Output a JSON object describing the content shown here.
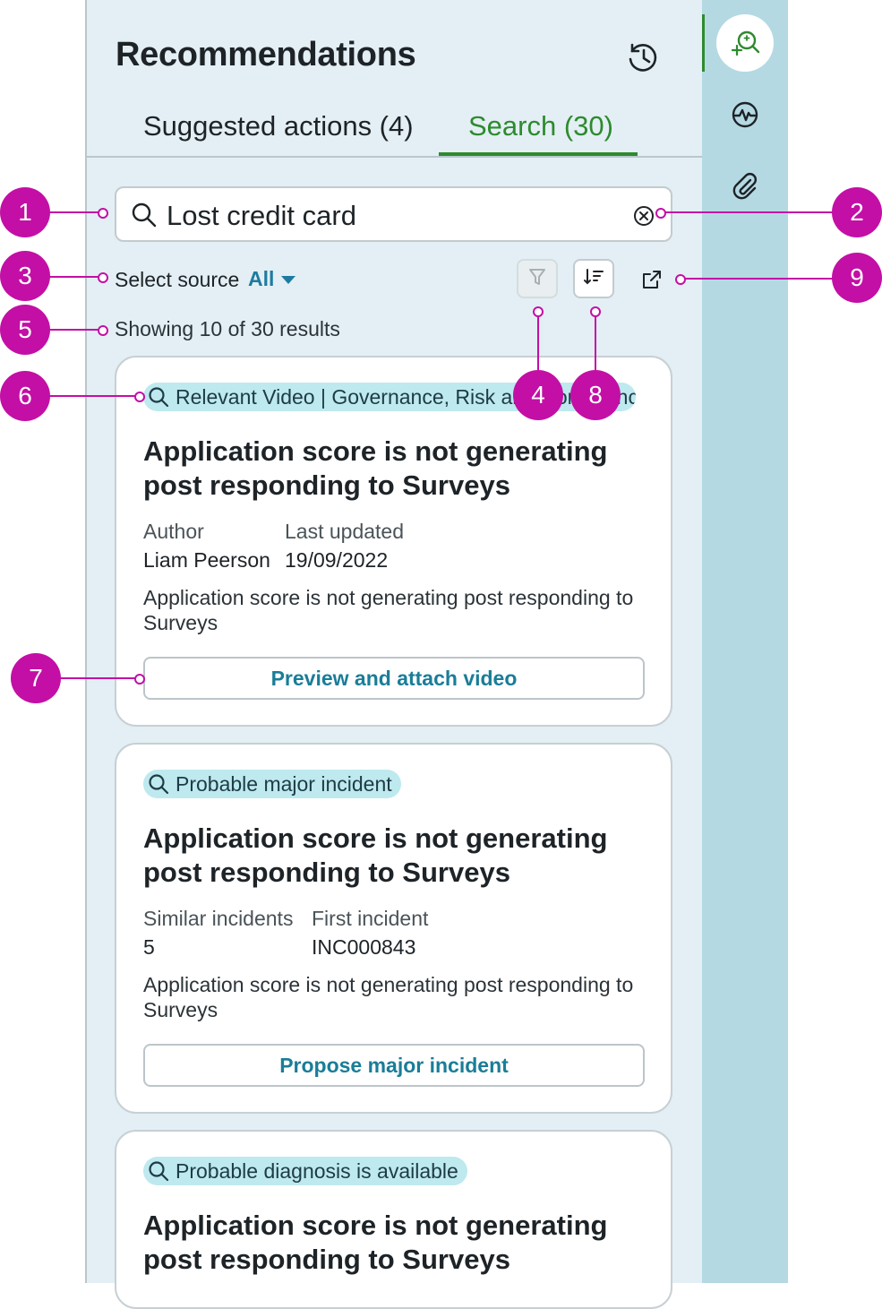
{
  "header": {
    "title": "Recommendations",
    "history_icon": "history-icon"
  },
  "tabs": [
    {
      "label": "Suggested actions (4)",
      "selected": false
    },
    {
      "label": "Search (30)",
      "selected": true
    }
  ],
  "search": {
    "value": "Lost credit card",
    "search_icon": "search-icon",
    "clear_icon": "clear-circle-icon"
  },
  "source": {
    "label": "Select source",
    "value": "All"
  },
  "toolbar": {
    "filter_icon": "filter-icon",
    "sort_icon": "sort-icon",
    "open_external_icon": "open-external-icon"
  },
  "results": {
    "count_text": "Showing 10 of 30 results"
  },
  "cards": [
    {
      "tag": "Relevant Video | Governance, Risk and Compliance..",
      "title": "Application score is not generating post responding to Surveys",
      "meta": [
        {
          "key": "Author",
          "value": "Liam Peerson"
        },
        {
          "key": "Last updated",
          "value": "19/09/2022"
        }
      ],
      "description": "Application score is not generating post responding to Surveys",
      "action": "Preview and attach video"
    },
    {
      "tag": "Probable major incident",
      "title": "Application score is not generating post responding to Surveys",
      "meta": [
        {
          "key": "Similar incidents",
          "value": "5"
        },
        {
          "key": "First incident",
          "value": "INC000843"
        }
      ],
      "description": "Application score is not generating post responding to Surveys",
      "action": "Propose major incident"
    },
    {
      "tag": "Probable diagnosis is available",
      "title": "Application score is not generating post responding to Surveys"
    }
  ],
  "rail": {
    "items": [
      "ai-search-icon",
      "activity-icon",
      "attachment-icon"
    ]
  },
  "callouts": [
    "1",
    "2",
    "3",
    "4",
    "5",
    "6",
    "7",
    "8",
    "9"
  ],
  "colors": {
    "accent_green": "#2e8a2e",
    "action_blue": "#1a7d98",
    "callout_magenta": "#c30fa5",
    "chip_bg": "#bde9ef",
    "panel_bg": "#e3eff4",
    "rail_bg": "#b4d9e3"
  }
}
